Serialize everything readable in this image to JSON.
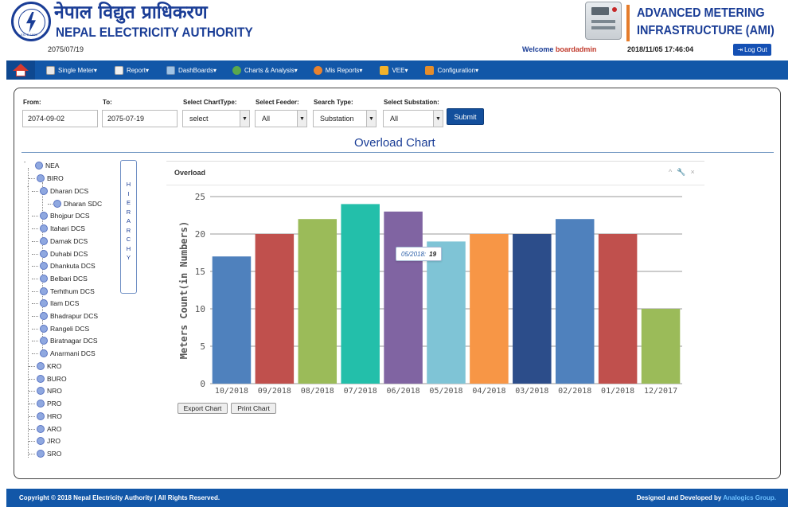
{
  "header": {
    "nepali_title": "नेपाल विद्युत प्राधिकरण",
    "english_title": "NEPAL ELECTRICITY AUTHORITY",
    "logo_estd": "ESTD 1985",
    "nepali_date": "2075/07/19",
    "ami_line1": "ADVANCED METERING",
    "ami_line2": "INFRASTRUCTURE (AMI)",
    "welcome_label": "Welcome",
    "username": "boardadmin",
    "datetime": "2018/11/05 17:46:04",
    "logout_label": "Log Out"
  },
  "nav": {
    "items": [
      {
        "label": "Single Meter",
        "icon": "meter-icon"
      },
      {
        "label": "Report",
        "icon": "report-icon"
      },
      {
        "label": "DashBoards",
        "icon": "dashboard-icon"
      },
      {
        "label": "Charts & Analysis",
        "icon": "chart-icon"
      },
      {
        "label": "Mis Reports",
        "icon": "mis-report-icon"
      },
      {
        "label": "VEE",
        "icon": "vee-icon"
      },
      {
        "label": "Configuration",
        "icon": "config-icon"
      }
    ],
    "dropdown_caret": "▾"
  },
  "filters": {
    "from_label": "From:",
    "from_value": "2074-09-02",
    "to_label": "To:",
    "to_value": "2075-07-19",
    "charttype_label": "Select ChartType:",
    "charttype_value": "select",
    "feeder_label": "Select Feeder:",
    "feeder_value": "All",
    "searchtype_label": "Search Type:",
    "searchtype_value": "Substation",
    "substation_label": "Select Substation:",
    "substation_value": "All",
    "submit_label": "Submit"
  },
  "page_title": "Overload Chart",
  "hierarchy_label": "HIERARCHY",
  "tree": {
    "root": "NEA",
    "biro": "BIRO",
    "biro_children": [
      "Dharan DCS",
      "Dharan SDC",
      "Bhojpur DCS",
      "Itahari DCS",
      "Damak DCS",
      "Duhabi DCS",
      "Dhankuta DCS",
      "Belbari DCS",
      "Terhthum DCS",
      "Ilam DCS",
      "Bhadrapur DCS",
      "Rangeli DCS",
      "Biratnagar DCS",
      "Anarmani DCS"
    ],
    "others": [
      "KRO",
      "BURO",
      "NRO",
      "PRO",
      "HRO",
      "ARO",
      "JRO",
      "SRO"
    ]
  },
  "chart_box": {
    "title": "Overload",
    "tools": [
      "^",
      "🔧",
      "×"
    ]
  },
  "chart_data": {
    "type": "bar",
    "categories": [
      "10/2018",
      "09/2018",
      "08/2018",
      "07/2018",
      "06/2018",
      "05/2018",
      "04/2018",
      "03/2018",
      "02/2018",
      "01/2018",
      "12/2017"
    ],
    "values": [
      17,
      20,
      22,
      24,
      23,
      19,
      20,
      20,
      22,
      20,
      10
    ],
    "colors": [
      "#4f81bd",
      "#c0504d",
      "#9bbb59",
      "#23bfaa",
      "#8064a2",
      "#7fc4d6",
      "#f79646",
      "#2c4d8a",
      "#4f81bd",
      "#c0504d",
      "#9bbb59"
    ],
    "ylabel": "Meters Count(in Numbers)",
    "xlabel": "",
    "ylim": [
      0,
      25
    ],
    "yticks": [
      0,
      5,
      10,
      15,
      20,
      25
    ],
    "grid": true,
    "tooltip": {
      "category": "05/2018:",
      "value": "19"
    }
  },
  "buttons": {
    "export": "Export Chart",
    "print": "Print Chart"
  },
  "footer": {
    "copyright": "Copyright © 2018 Nepal Electricity Authority | All Rights Reserved.",
    "designed_by": "Designed and Developed by",
    "company": "Analogics Group."
  }
}
